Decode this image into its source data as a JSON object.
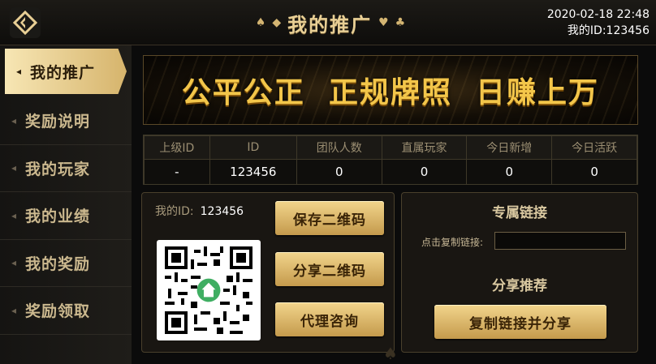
{
  "header": {
    "back_icon": "back-arrow-icon",
    "title": "我的推广",
    "datetime": "2020-02-18 22:48",
    "my_id_line": "我的ID:123456"
  },
  "sidebar": {
    "items": [
      {
        "label": "我的推广",
        "active": true
      },
      {
        "label": "奖励说明",
        "active": false
      },
      {
        "label": "我的玩家",
        "active": false
      },
      {
        "label": "我的业绩",
        "active": false
      },
      {
        "label": "我的奖励",
        "active": false
      },
      {
        "label": "奖励领取",
        "active": false
      }
    ]
  },
  "banner": {
    "text": "公平公正  正规牌照  日赚上万"
  },
  "stats": {
    "headers": [
      "上级ID",
      "ID",
      "团队人数",
      "直属玩家",
      "今日新增",
      "今日活跃"
    ],
    "values": [
      "-",
      "123456",
      "0",
      "0",
      "0",
      "0"
    ]
  },
  "qr_panel": {
    "id_label": "我的ID:",
    "id_value": "123456",
    "save_qr": "保存二维码",
    "share_qr": "分享二维码",
    "agent_consult": "代理咨询"
  },
  "link_panel": {
    "title": "专属链接",
    "copy_label": "点击复制链接:",
    "link_value": "",
    "share_title": "分享推荐",
    "copy_share_button": "复制链接并分享"
  },
  "colors": {
    "gold": "#e8cf95",
    "button_gold": "#d9b364",
    "background": "#0b0b0b"
  }
}
